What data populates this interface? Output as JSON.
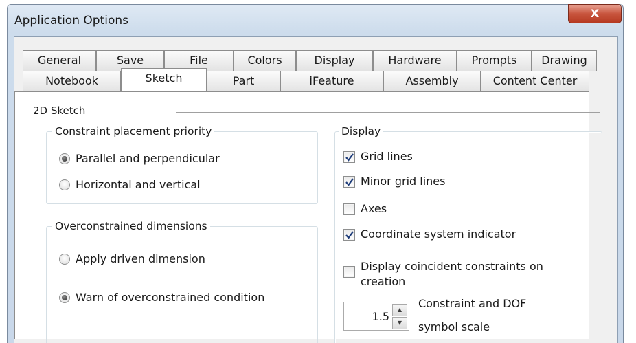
{
  "window": {
    "title": "Application Options",
    "close_glyph": "X"
  },
  "tabs": {
    "row1": [
      "General",
      "Save",
      "File",
      "Colors",
      "Display",
      "Hardware",
      "Prompts",
      "Drawing"
    ],
    "row2": [
      "Notebook",
      "Sketch",
      "Part",
      "iFeature",
      "Assembly",
      "Content Center"
    ],
    "active": "Sketch"
  },
  "sketch_panel": {
    "section_title": "2D Sketch",
    "constraint_placement": {
      "label": "Constraint placement priority",
      "options": [
        {
          "label": "Parallel and perpendicular",
          "selected": true
        },
        {
          "label": "Horizontal and vertical",
          "selected": false
        }
      ]
    },
    "overconstrained": {
      "label": "Overconstrained dimensions",
      "options": [
        {
          "label": "Apply driven dimension",
          "selected": false
        },
        {
          "label": "Warn of overconstrained condition",
          "selected": true
        }
      ]
    },
    "display": {
      "label": "Display",
      "checkboxes": [
        {
          "label": "Grid lines",
          "checked": true
        },
        {
          "label": "Minor grid lines",
          "checked": true
        },
        {
          "label": "Axes",
          "checked": false
        },
        {
          "label": "Coordinate system indicator",
          "checked": true
        },
        {
          "label": "Display coincident constraints on",
          "label2": "creation",
          "checked": false
        }
      ],
      "symbol_scale": {
        "value": "1.5",
        "label_line1": "Constraint and DOF",
        "label_line2": "symbol scale"
      }
    }
  }
}
